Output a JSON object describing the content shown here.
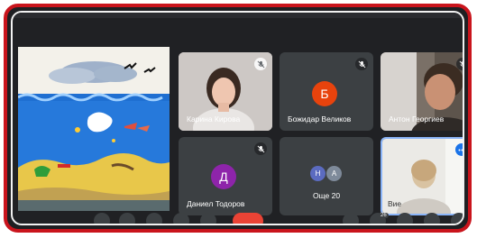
{
  "participants": [
    {
      "name": "Карина Кирова",
      "muted": true,
      "video": true
    },
    {
      "name": "Божидар Великов",
      "muted": true,
      "initial": "Б",
      "avatar_color": "#e8430d"
    },
    {
      "name": "Антон Георгиев",
      "muted": true,
      "video": true
    },
    {
      "name": "Даниел Тодоров",
      "muted": true,
      "initial": "Д",
      "avatar_color": "#8e24aa"
    },
    {
      "name": "Вие",
      "is_self": true,
      "video": true
    }
  ],
  "overflow": {
    "label": "Още 20",
    "avatars": [
      {
        "initial": "Н",
        "color": "#5b6bc0"
      },
      {
        "initial": "A",
        "color": "#7e8a9a"
      }
    ]
  },
  "toolbar": {
    "participants_badge": "26"
  },
  "colors": {
    "accent": "#1a73e8",
    "frame": "#c9141c",
    "end_call": "#ea4335",
    "tile_bg": "#3c4043"
  }
}
